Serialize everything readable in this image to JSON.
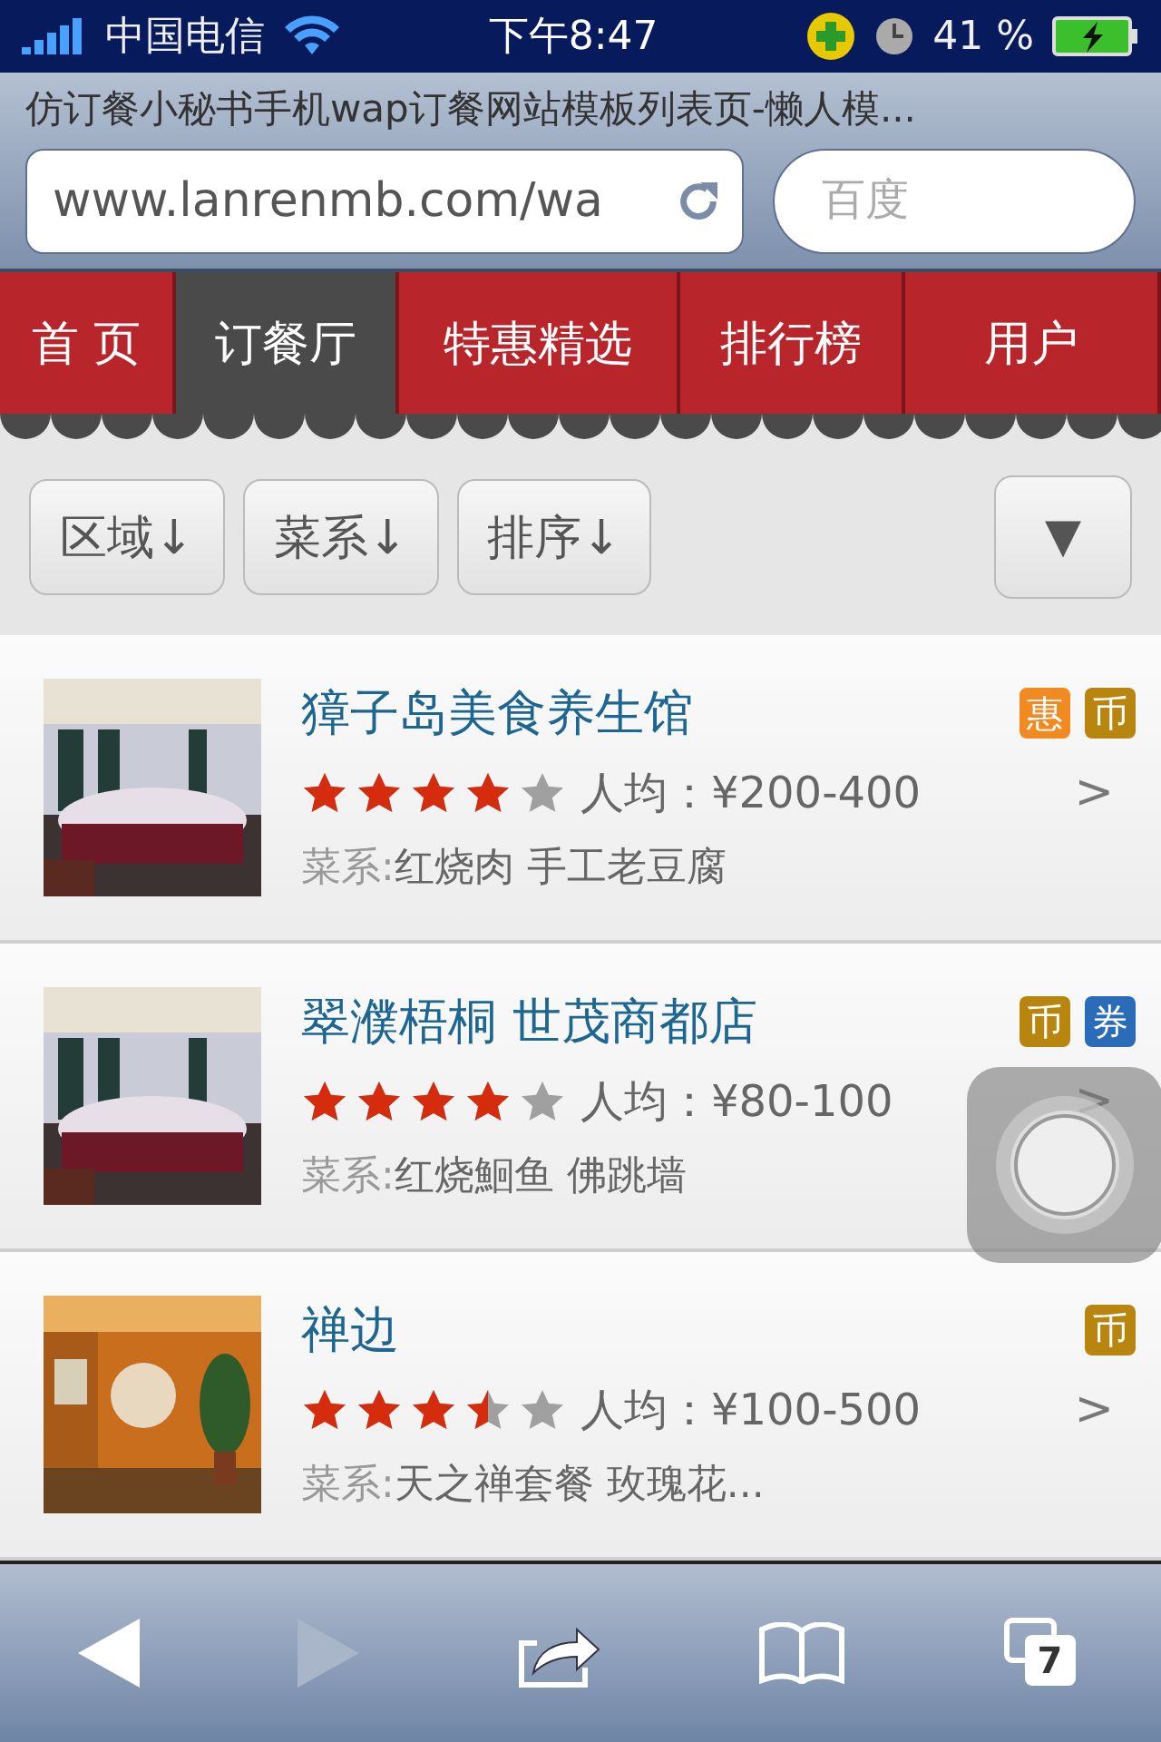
{
  "status_bar": {
    "carrier": "中国电信",
    "time": "下午8:47",
    "battery": "41 %"
  },
  "browser": {
    "page_title": "仿订餐小秘书手机wap订餐网站模板列表页-懒人模...",
    "url": "www.lanrenmb.com/wa",
    "search_placeholder": "百度"
  },
  "nav_tabs": [
    {
      "label": "首 页",
      "selected": false
    },
    {
      "label": "订餐厅",
      "selected": true
    },
    {
      "label": "特惠精选",
      "selected": false
    },
    {
      "label": "排行榜",
      "selected": false
    },
    {
      "label": "用户",
      "selected": false
    }
  ],
  "filters": [
    "区域↓",
    "菜系↓",
    "排序↓"
  ],
  "filter_toggle": "▼",
  "restaurants": [
    {
      "name": "獐子岛美食养生馆",
      "stars": 4,
      "price": "人均：¥200-400",
      "cuisine_label": "菜系:",
      "cuisine": "红烧肉 手工老豆腐",
      "arrow": ">",
      "badges": [
        {
          "label": "惠",
          "color": "#f28a22"
        },
        {
          "label": "币",
          "color": "#b8860e"
        }
      ]
    },
    {
      "name": "翠濮梧桐 世茂商都店",
      "stars": 4,
      "price": "人均：¥80-100",
      "cuisine_label": "菜系:",
      "cuisine": "红烧鮰鱼 佛跳墙",
      "arrow": ">",
      "badges": [
        {
          "label": "币",
          "color": "#b8860e"
        },
        {
          "label": "券",
          "color": "#2b6cb8"
        }
      ]
    },
    {
      "name": "禅边",
      "stars": 3.5,
      "price": "人均：¥100-500",
      "cuisine_label": "菜系:",
      "cuisine": "天之禅套餐 玫瑰花...",
      "arrow": ">",
      "badges": [
        {
          "label": "币",
          "color": "#b8860e"
        }
      ]
    }
  ],
  "toolbar": {
    "tab_count": "7"
  }
}
